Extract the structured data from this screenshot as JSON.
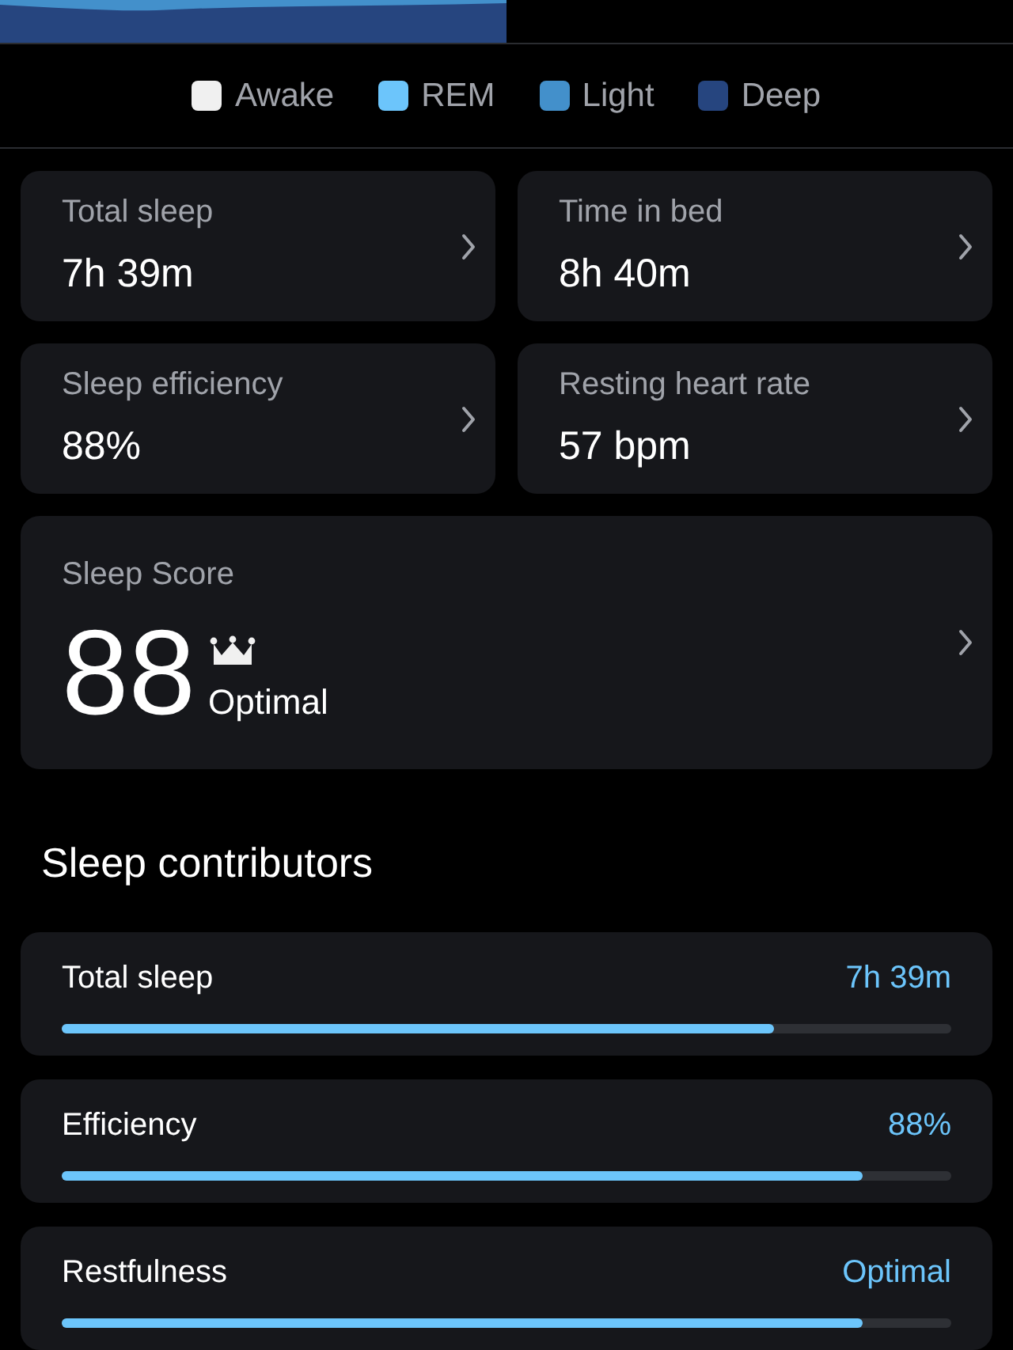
{
  "legend": [
    {
      "label": "Awake",
      "color": "#f0f0f0"
    },
    {
      "label": "REM",
      "color": "#6cc5fb"
    },
    {
      "label": "Light",
      "color": "#4390cb"
    },
    {
      "label": "Deep",
      "color": "#26457f"
    }
  ],
  "metrics": [
    {
      "label": "Total sleep",
      "value": "7h 39m"
    },
    {
      "label": "Time in bed",
      "value": "8h 40m"
    },
    {
      "label": "Sleep efficiency",
      "value": "88%"
    },
    {
      "label": "Resting heart rate",
      "value": "57 bpm"
    }
  ],
  "score": {
    "label": "Sleep Score",
    "value": "88",
    "rating": "Optimal"
  },
  "contributors_title": "Sleep contributors",
  "contributors": [
    {
      "label": "Total sleep",
      "value": "7h 39m",
      "level": 0.8
    },
    {
      "label": "Efficiency",
      "value": "88%",
      "level": 0.9
    },
    {
      "label": "Restfulness",
      "value": "Optimal",
      "level": 0.9
    }
  ]
}
